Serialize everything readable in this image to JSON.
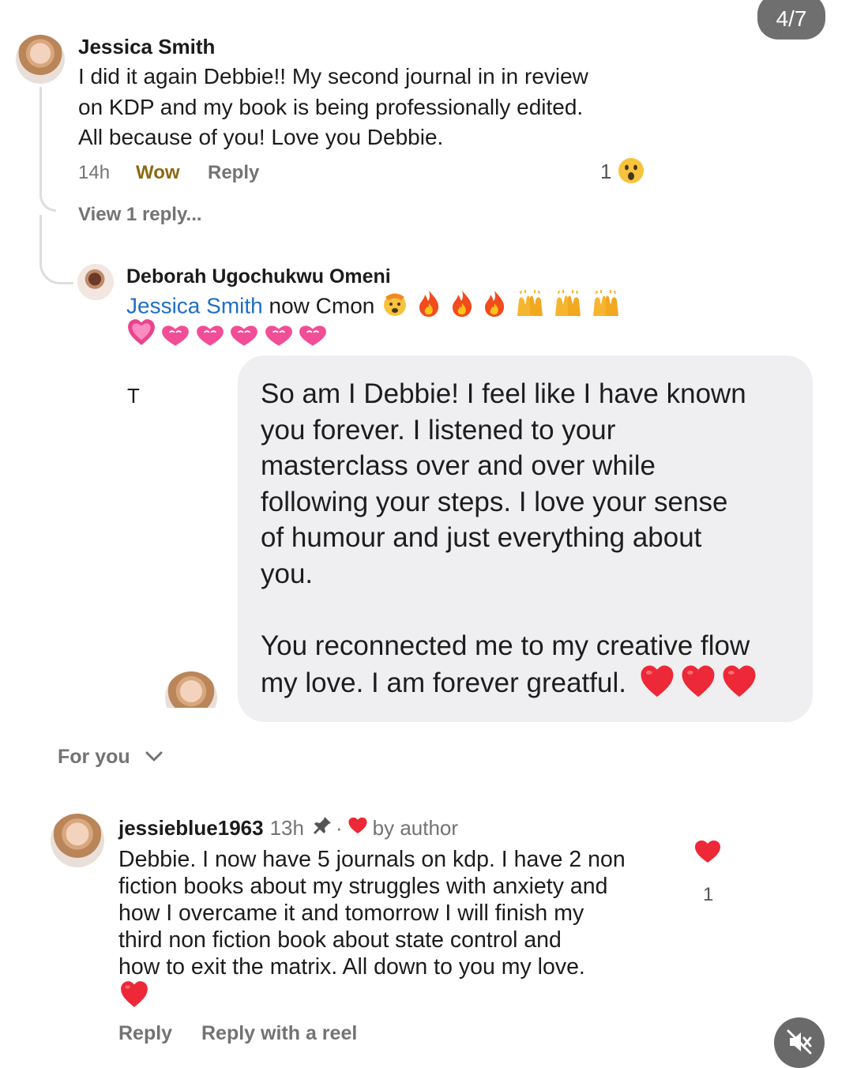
{
  "story": {
    "counter": "4/7"
  },
  "comment1": {
    "author": "Jessica Smith",
    "lines": [
      "I did it again Debbie!! My second journal in in review",
      "on KDP and my book is being professionally edited.",
      "All because of you! Love you Debbie."
    ],
    "time": "14h",
    "reaction_label": "Wow",
    "reply_label": "Reply",
    "reaction_count": "1",
    "reaction_icon": "wow-emoji-icon",
    "view_replies": "View 1 reply..."
  },
  "reply1": {
    "author": "Deborah Ugochukwu Omeni",
    "mention": "Jessica Smith",
    "text": "now Cmon",
    "emojis": [
      "exploding-head-emoji",
      "fire-emoji",
      "fire-emoji",
      "fire-emoji",
      "raising-hands-emoji",
      "raising-hands-emoji",
      "raising-hands-emoji"
    ],
    "hearts": [
      "pink-heart-emoji",
      "pink-heart-emoji",
      "pink-heart-emoji",
      "pink-heart-emoji",
      "pink-heart-emoji",
      "pink-heart-emoji"
    ]
  },
  "message": {
    "marker": "T",
    "lines_p1": [
      "So am I Debbie! I feel like I have known",
      "you forever. I listened to your",
      "masterclass over and over while",
      "following your steps. I love your sense",
      "of humour and just everything about",
      "you."
    ],
    "lines_p2": [
      "You reconnected me to my creative flow",
      "my love. I am forever greatful."
    ],
    "trailing_emojis": [
      "red-heart-emoji",
      "red-heart-emoji",
      "red-heart-emoji"
    ]
  },
  "section": {
    "label": "For you"
  },
  "comment2": {
    "author": "jessieblue1963",
    "time": "13h",
    "badge": "by author",
    "lines": [
      "Debbie. I now have 5 journals on kdp. I have 2 non",
      "fiction books about my struggles with anxiety and",
      "how I overcame it and tomorrow I will finish my",
      "third non fiction book about state control and",
      "how to exit the matrix. All down to you my love."
    ],
    "like_count": "1",
    "reply_label": "Reply",
    "reel_label": "Reply with a reel"
  },
  "colors": {
    "wow": "#8a6a12",
    "mention": "#1e6fc5",
    "heart": "#ed2837",
    "bubble": "#efeff1"
  }
}
